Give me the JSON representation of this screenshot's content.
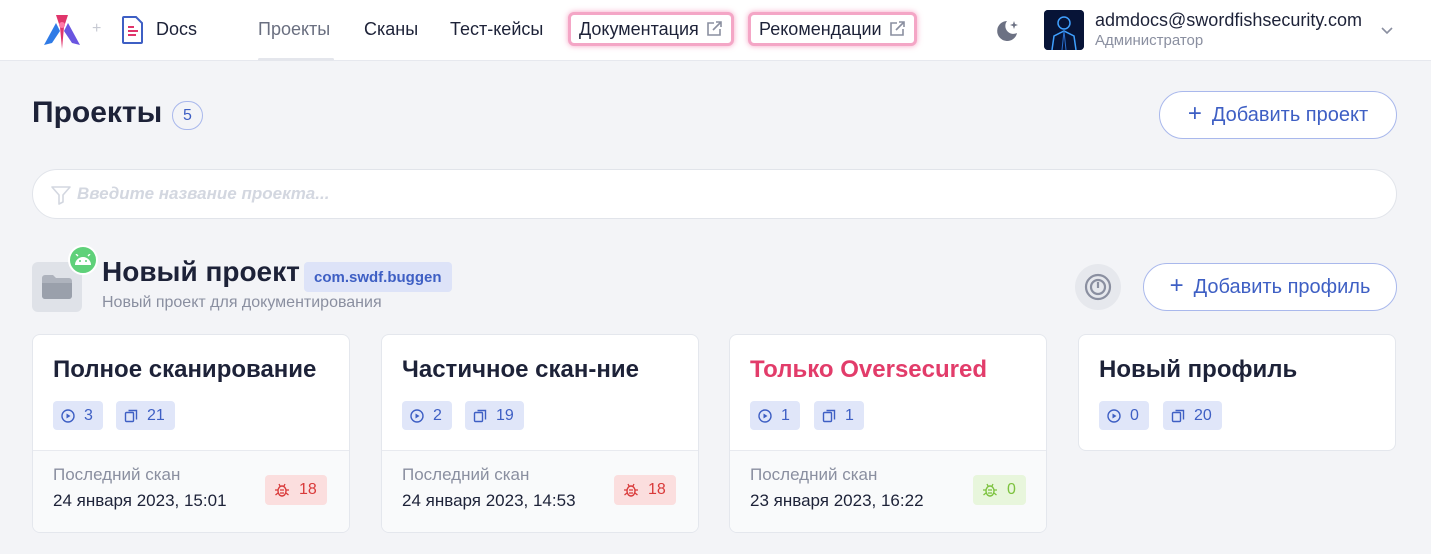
{
  "header": {
    "product": "Docs",
    "nav": [
      {
        "label": "Проекты",
        "active": true
      },
      {
        "label": "Сканы"
      },
      {
        "label": "Тест-кейсы"
      }
    ],
    "external_links": [
      {
        "label": "Документация"
      },
      {
        "label": "Рекомендации"
      }
    ],
    "user": {
      "email": "admdocs@swordfishsecurity.com",
      "role": "Администратор"
    }
  },
  "page": {
    "title": "Проекты",
    "count": "5",
    "add_project_label": "Добавить проект",
    "search_placeholder": "Введите название проекта..."
  },
  "project": {
    "name": "Новый проект",
    "package": "com.swdf.buggen",
    "description": "Новый проект для документирования",
    "add_profile_label": "Добавить профиль",
    "platform_icon": "android-icon"
  },
  "cards": [
    {
      "title": "Полное сканирование",
      "title_color": "#1d2238",
      "scans": "3",
      "cases": "21",
      "last_label": "Последний скан",
      "last_date": "24 января 2023, 15:01",
      "bugs": "18",
      "bug_status": "red"
    },
    {
      "title": "Частичное скан-ние",
      "title_color": "#1d2238",
      "scans": "2",
      "cases": "19",
      "last_label": "Последний скан",
      "last_date": "24 января 2023, 14:53",
      "bugs": "18",
      "bug_status": "red"
    },
    {
      "title": "Только Oversecured",
      "title_color": "#e23c6a",
      "scans": "1",
      "cases": "1",
      "last_label": "Последний скан",
      "last_date": "23 января 2023, 16:22",
      "bugs": "0",
      "bug_status": "green"
    },
    {
      "title": "Новый профиль",
      "title_color": "#1d2238",
      "scans": "0",
      "cases": "20"
    }
  ]
}
